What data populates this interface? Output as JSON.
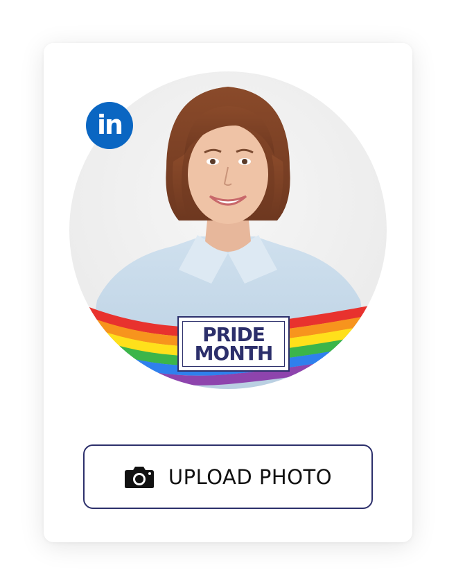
{
  "badge": {
    "icon": "linkedin-icon",
    "text": "in",
    "color": "#0A66C2"
  },
  "frame": {
    "line1": "PRIDE",
    "line2": "MONTH",
    "text_color": "#2c2f6b"
  },
  "rainbow_colors": [
    "#e8322e",
    "#f7941d",
    "#ffe01b",
    "#3bb54a",
    "#2f80ed",
    "#8e44ad"
  ],
  "upload": {
    "label": "UPLOAD PHOTO",
    "icon": "camera-icon",
    "border_color": "#2c2f6b"
  }
}
